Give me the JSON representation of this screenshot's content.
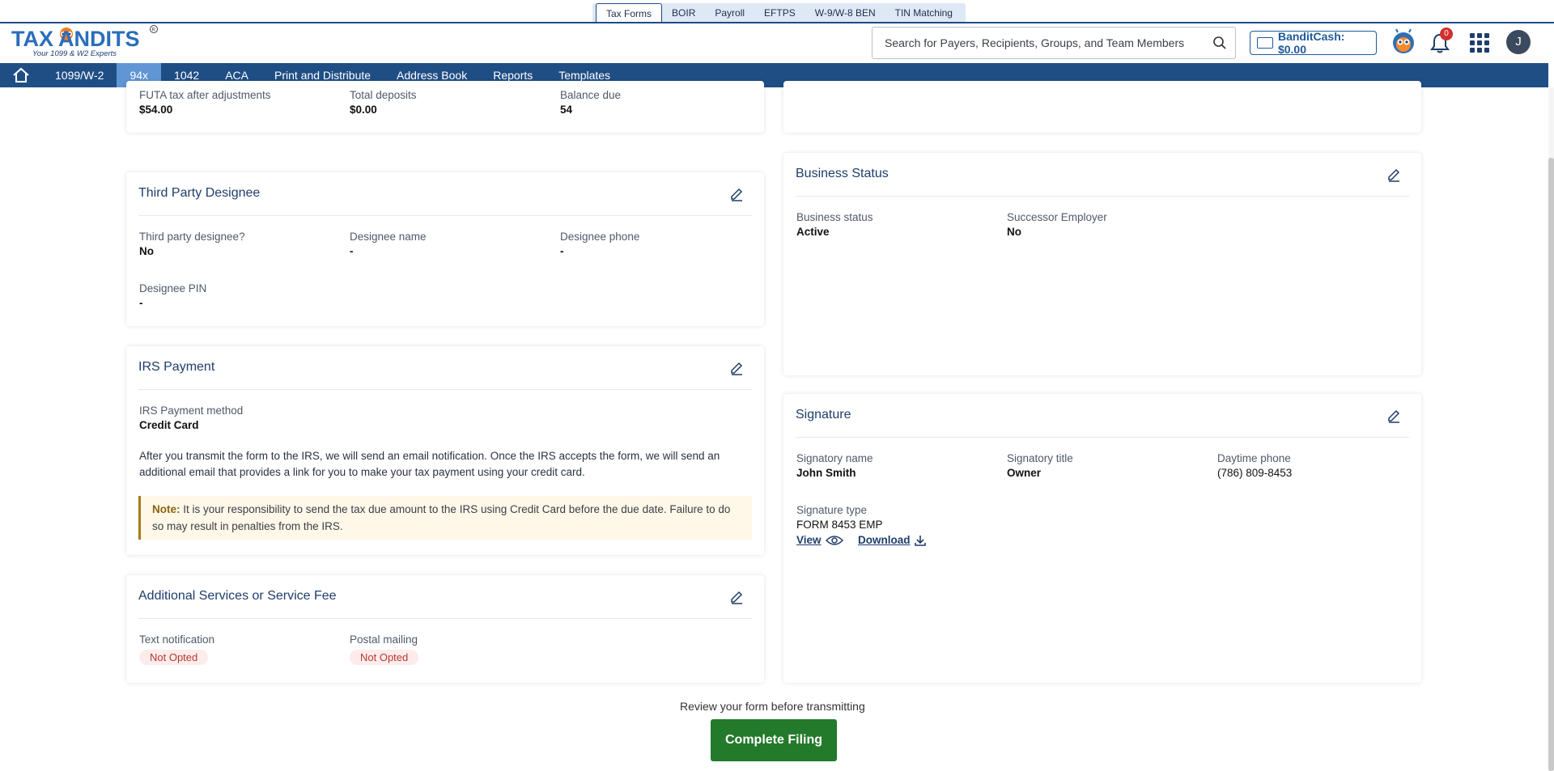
{
  "product_tabs": [
    "Tax Forms",
    "BOIR",
    "Payroll",
    "EFTPS",
    "W-9/W-8 BEN",
    "TIN Matching"
  ],
  "logo": {
    "text": "TAXBANDITS",
    "tagline": "Your 1099 & W2 Experts"
  },
  "search": {
    "placeholder": "Search for Payers, Recipients, Groups, and Team Members"
  },
  "bandit_cash": {
    "label": "BanditCash: $0.00"
  },
  "notifications": {
    "count": "0"
  },
  "user": {
    "initial": "J"
  },
  "nav": {
    "items": [
      "1099/W-2",
      "94x",
      "1042",
      "ACA",
      "Print and Distribute",
      "Address Book",
      "Reports",
      "Templates"
    ],
    "active": "94x"
  },
  "futa": {
    "fields": [
      {
        "label": "FUTA tax after adjustments",
        "value": "$54.00"
      },
      {
        "label": "Total deposits",
        "value": "$0.00"
      },
      {
        "label": "Balance due",
        "value": "54"
      }
    ]
  },
  "third_party": {
    "title": "Third Party Designee",
    "fields": [
      {
        "label": "Third party designee?",
        "value": "No"
      },
      {
        "label": "Designee name",
        "value": "-"
      },
      {
        "label": "Designee phone",
        "value": "-"
      },
      {
        "label": "Designee PIN",
        "value": "-"
      }
    ]
  },
  "irs_payment": {
    "title": "IRS Payment",
    "method_label": "IRS Payment method",
    "method_value": "Credit Card",
    "description": "After you transmit the form to the IRS, we will send an email notification. Once the IRS accepts the form, we will send an additional email that provides a link for you to make your tax payment using your credit card.",
    "note_label": "Note:",
    "note_text": " It is your responsibility to send the tax due amount to the IRS using Credit Card before the due date. Failure to do so may result in penalties from the IRS."
  },
  "additional_services": {
    "title": "Additional Services or Service Fee",
    "fields": [
      {
        "label": "Text notification",
        "value": "Not Opted"
      },
      {
        "label": "Postal mailing",
        "value": "Not Opted"
      }
    ]
  },
  "business_status": {
    "title": "Business Status",
    "fields": [
      {
        "label": "Business status",
        "value": "Active"
      },
      {
        "label": "Successor Employer",
        "value": "No"
      }
    ]
  },
  "signature": {
    "title": "Signature",
    "fields": [
      {
        "label": "Signatory name",
        "value": "John Smith"
      },
      {
        "label": "Signatory title",
        "value": "Owner"
      },
      {
        "label": "Daytime phone",
        "value": "(786) 809-8453"
      },
      {
        "label": "Signature type",
        "value": "FORM 8453 EMP"
      }
    ],
    "view_label": "View",
    "download_label": "Download"
  },
  "footer": {
    "review_text": "Review your form before transmitting",
    "complete_button": "Complete Filing"
  },
  "colors": {
    "nav_bg": "#1f4e85",
    "nav_active": "#5f96d3",
    "primary_text": "#1e3d6b",
    "complete_green": "#237a2a"
  }
}
